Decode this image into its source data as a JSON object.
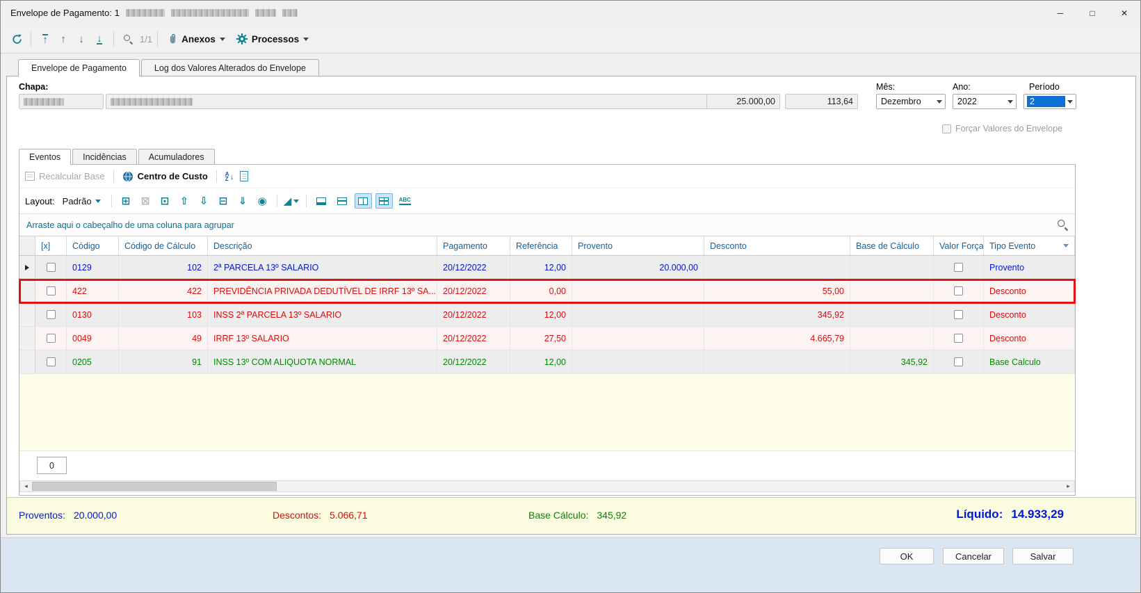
{
  "window": {
    "title": "Envelope de Pagamento: 1",
    "minimize": "─",
    "maximize": "□",
    "close": "✕"
  },
  "toolbar": {
    "page_indicator": "1/1",
    "anexos": "Anexos",
    "processos": "Processos"
  },
  "tabs": {
    "tab1": "Envelope de Pagamento",
    "tab2": "Log dos Valores Alterados do Envelope"
  },
  "form": {
    "chapa_label": "Chapa:",
    "valor1": "25.000,00",
    "valor2": "113,64",
    "mes_label": "Mês:",
    "mes": "Dezembro",
    "ano_label": "Ano:",
    "ano": "2022",
    "periodo_label": "Período",
    "periodo": "2",
    "forcar": "Forçar Valores do Envelope"
  },
  "inner_tabs": {
    "eventos": "Eventos",
    "incidencias": "Incidências",
    "acumuladores": "Acumuladores"
  },
  "grid_toolbar": {
    "recalcular": "Recalcular Base",
    "centro_custo": "Centro de Custo",
    "layout_label": "Layout:",
    "padrao": "Padrão",
    "abc": "ABC"
  },
  "group_bar": {
    "hint": "Arraste aqui o cabeçalho de uma coluna para agrupar"
  },
  "grid": {
    "columns": {
      "check": "[x]",
      "codigo": "Código",
      "codigo_calculo": "Código de Cálculo",
      "descricao": "Descrição",
      "pagamento": "Pagamento",
      "referencia": "Referência",
      "provento": "Provento",
      "desconto": "Desconto",
      "base_calculo": "Base de Cálculo",
      "valor_forcado": "Valor Forçado",
      "tipo_evento": "Tipo Evento"
    },
    "rows": [
      {
        "codigo": "0129",
        "codigo_calculo": "102",
        "descricao": "2ª PARCELA 13º SALARIO",
        "pagamento": "20/12/2022",
        "referencia": "12,00",
        "provento": "20.000,00",
        "desconto": "",
        "base_calculo": "",
        "tipo": "Provento"
      },
      {
        "codigo": "422",
        "codigo_calculo": "422",
        "descricao": "PREVIDÊNCIA PRIVADA DEDUTÍVEL DE IRRF 13º SA...",
        "pagamento": "20/12/2022",
        "referencia": "0,00",
        "provento": "",
        "desconto": "55,00",
        "base_calculo": "",
        "tipo": "Desconto"
      },
      {
        "codigo": "0130",
        "codigo_calculo": "103",
        "descricao": "INSS 2ª PARCELA 13º SALARIO",
        "pagamento": "20/12/2022",
        "referencia": "12,00",
        "provento": "",
        "desconto": "345,92",
        "base_calculo": "",
        "tipo": "Desconto"
      },
      {
        "codigo": "0049",
        "codigo_calculo": "49",
        "descricao": "IRRF 13º SALARIO",
        "pagamento": "20/12/2022",
        "referencia": "27,50",
        "provento": "",
        "desconto": "4.665,79",
        "base_calculo": "",
        "tipo": "Desconto"
      },
      {
        "codigo": "0205",
        "codigo_calculo": "91",
        "descricao": "INSS 13º COM ALIQUOTA NORMAL",
        "pagamento": "20/12/2022",
        "referencia": "12,00",
        "provento": "",
        "desconto": "",
        "base_calculo": "345,92",
        "tipo": "Base Calculo"
      }
    ],
    "record_count": "0"
  },
  "totals": {
    "proventos_label": "Proventos:",
    "proventos": "20.000,00",
    "descontos_label": "Descontos:",
    "descontos": "5.066,71",
    "base_label": "Base Cálculo:",
    "base": "345,92",
    "liquido_label": "Líquido:",
    "liquido": "14.933,29"
  },
  "actions": {
    "ok": "OK",
    "cancelar": "Cancelar",
    "salvar": "Salvar"
  },
  "colors": {
    "provento_text": "#0014D2",
    "desconto_text": "#D40E0E",
    "base_calculo_text": "#008A00",
    "accent_teal": "#0F8294",
    "row_highlight_border": "#E01212",
    "selection_blue": "#0E6FD6"
  }
}
